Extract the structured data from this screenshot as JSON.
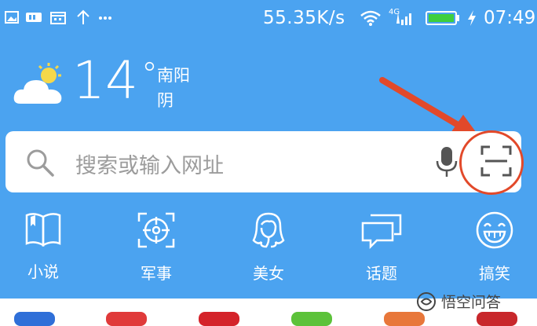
{
  "status_bar": {
    "net_speed": "55.35K/s",
    "network_type": "4G",
    "time": "07:49",
    "icons": [
      "image-icon",
      "sim-icon",
      "calendar-icon",
      "upload-icon",
      "more-dots-icon",
      "wifi-icon",
      "signal-icon",
      "battery-icon",
      "charging-icon"
    ]
  },
  "weather": {
    "temperature": "14",
    "degree_symbol": "°",
    "city": "南阳",
    "condition": "阴",
    "icon": "partly-cloudy-icon"
  },
  "search": {
    "placeholder": "搜索或输入网址",
    "icons": [
      "search-icon",
      "mic-icon",
      "scan-icon"
    ]
  },
  "categories": [
    {
      "label": "小说",
      "icon": "book-icon"
    },
    {
      "label": "军事",
      "icon": "crosshair-icon"
    },
    {
      "label": "美女",
      "icon": "woman-icon"
    },
    {
      "label": "话题",
      "icon": "chat-icon"
    },
    {
      "label": "搞笑",
      "icon": "laugh-icon"
    }
  ],
  "watermark": {
    "text": "悟空问答"
  },
  "colors": {
    "header_bg": "#4ba3f0",
    "annotation": "#e2492a",
    "white": "#ffffff"
  }
}
